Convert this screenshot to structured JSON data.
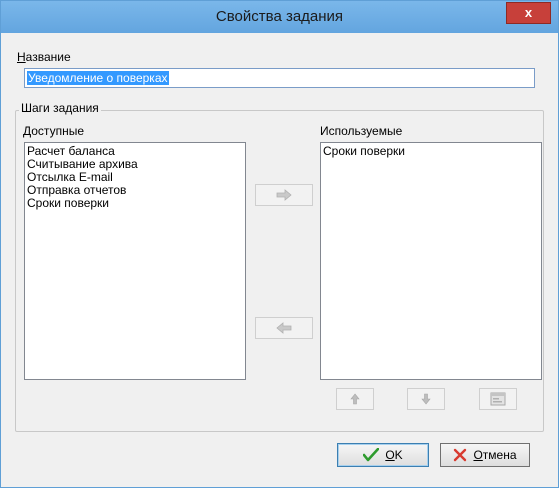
{
  "window": {
    "title": "Свойства задания",
    "close_label": "x"
  },
  "name_field": {
    "label": "Название",
    "label_mnemonic": "Н",
    "label_rest": "азвание",
    "value": "Уведомление о поверках"
  },
  "steps_group": {
    "title": "Шаги задания",
    "available": {
      "label": "Доступные",
      "items": [
        "Расчет баланса",
        "Считывание архива",
        "Отсылка E-mail",
        "Отправка отчетов",
        "Сроки поверки"
      ]
    },
    "used": {
      "label": "Используемые",
      "items": [
        "Сроки поверки"
      ]
    },
    "icons": {
      "add": "arrow-right-icon",
      "remove": "arrow-left-icon",
      "move_up": "arrow-up-icon",
      "move_down": "arrow-down-icon",
      "configure": "properties-icon"
    }
  },
  "footer": {
    "ok_label": "OK",
    "ok_mnemonic": "O",
    "ok_rest": "K",
    "cancel_label": "Отмена",
    "cancel_mnemonic": "О",
    "cancel_rest": "тмена"
  },
  "colors": {
    "titlebar": "#6aabe3",
    "selection": "#3399ff",
    "close_button": "#c7403a",
    "ok_check": "#2e9b2e",
    "cancel_x": "#d83a2f"
  }
}
